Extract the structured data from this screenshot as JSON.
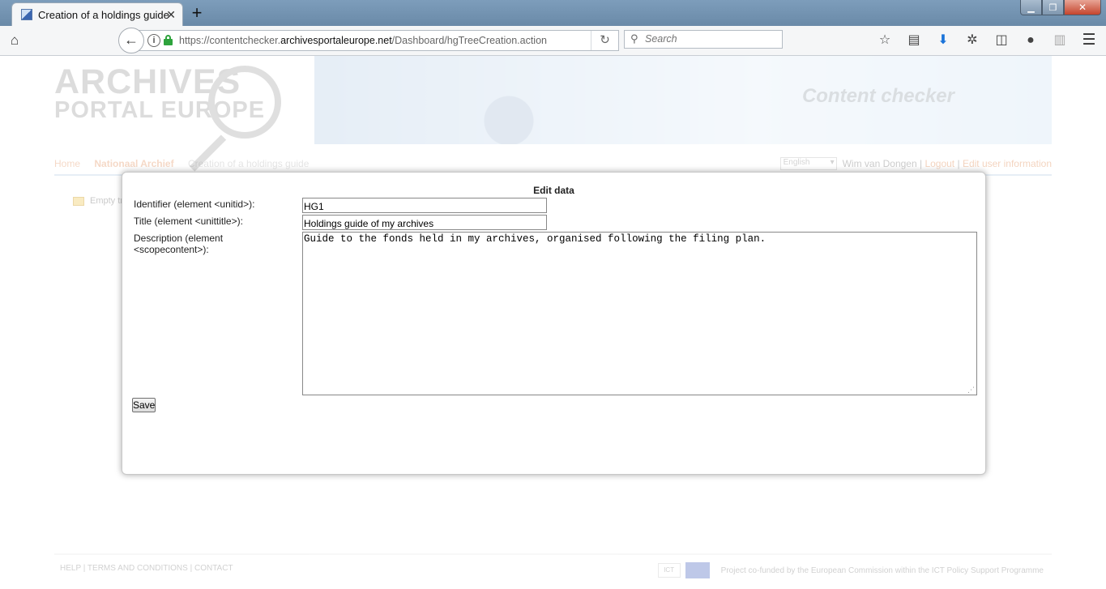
{
  "browser": {
    "tab_title": "Creation of a holdings guide",
    "url_prefix": "https://contentchecker.",
    "url_domain": "archivesportaleurope.net",
    "url_path": "/Dashboard/hgTreeCreation.action",
    "search_placeholder": "Search"
  },
  "page": {
    "logo_line1": "ARCHIVES",
    "logo_line2": "PORTAL EUROPE",
    "banner_title": "Content checker",
    "breadcrumbs": [
      "Home",
      "Nationaal Archief",
      "Creation of a holdings guide"
    ],
    "language": "English",
    "user_name": "Wim van Dongen",
    "logout": "Logout",
    "edit_user": "Edit user information",
    "tree_item": "Empty tree",
    "footer_links": "HELP |    TERMS AND CONDITIONS |    CONTACT",
    "footer_ict": "ICT",
    "footer_funding": "Project co-funded by the European Commission within the ICT Policy Support Programme"
  },
  "dialog": {
    "title": "Edit data",
    "identifier_label": "Identifier (element <unitid>):",
    "identifier_value": "HG1",
    "title_label": "Title (element <unittitle>):",
    "title_value": "Holdings guide of my archives",
    "description_label": "Description (element <scopecontent>):",
    "description_value": "Guide to the fonds held in my archives, organised following the filing plan.",
    "save_label": "Save"
  }
}
